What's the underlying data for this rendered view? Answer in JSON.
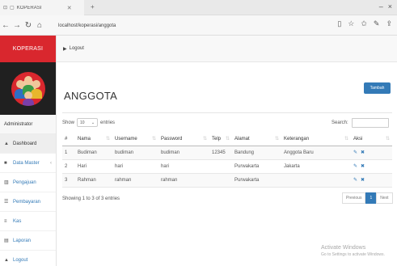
{
  "browser": {
    "tab_title": "KOPERASI",
    "url": "localhost/koperasi/anggota"
  },
  "sidebar": {
    "brand": "KOPERASI",
    "role": "Administrator",
    "items": [
      {
        "label": "Dashboard",
        "icon": "dashboard-icon",
        "glyph": "▲"
      },
      {
        "label": "Data Master",
        "icon": "list-icon",
        "glyph": "■"
      },
      {
        "label": "Pengajuan",
        "icon": "bar-chart-icon",
        "glyph": "▥"
      },
      {
        "label": "Pembayaran",
        "icon": "table-icon",
        "glyph": "☰"
      },
      {
        "label": "Kas",
        "icon": "menu-icon",
        "glyph": "≡"
      },
      {
        "label": "Laporan",
        "icon": "report-icon",
        "glyph": "▤"
      },
      {
        "label": "Logout",
        "icon": "user-icon",
        "glyph": "▲"
      }
    ]
  },
  "topbar": {
    "logout_label": "Logout"
  },
  "main": {
    "title": "ANGGOTA",
    "add_button": "Tambah",
    "show_label": "Show",
    "show_value": "10",
    "entries_label": "entries",
    "search_label": "Search:",
    "search_value": "",
    "columns": [
      "#",
      "Nama",
      "Username",
      "Password",
      "Telp",
      "Alamat",
      "Keterangan",
      "Aksi"
    ],
    "rows": [
      [
        "1",
        "Budiman",
        "budiman",
        "budiman",
        "12345",
        "Bandung",
        "Anggota Baru"
      ],
      [
        "2",
        "Hari",
        "hari",
        "hari",
        "",
        "Purwakarta",
        "Jakarta"
      ],
      [
        "3",
        "Rahman",
        "rahman",
        "rahman",
        "",
        "Purwakarta",
        ""
      ]
    ],
    "info": "Showing 1 to 3 of 3 entries",
    "pager": {
      "prev": "Previous",
      "current": "1",
      "next": "Next"
    }
  },
  "watermark": {
    "line1": "Activate Windows",
    "line2": "Go to Settings to activate Windows."
  }
}
